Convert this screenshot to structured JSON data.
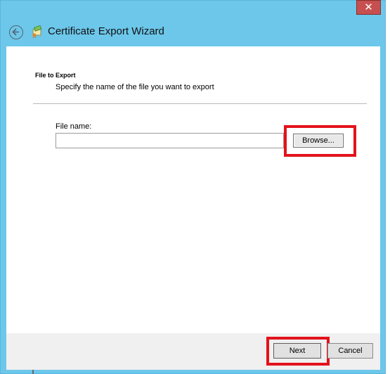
{
  "window": {
    "title": "Certificate Export Wizard",
    "close_label": "✕",
    "accent_color": "#6cc7ea"
  },
  "icons": {
    "back": "back-arrow-icon",
    "certificate": "certificate-icon"
  },
  "page": {
    "section_title": "File to Export",
    "section_description": "Specify the name of the file you want to export",
    "file_name_label": "File name:",
    "file_name_value": "",
    "browse_label": "Browse..."
  },
  "footer": {
    "next_label": "Next",
    "cancel_label": "Cancel"
  },
  "highlight_color": "#e3121c"
}
